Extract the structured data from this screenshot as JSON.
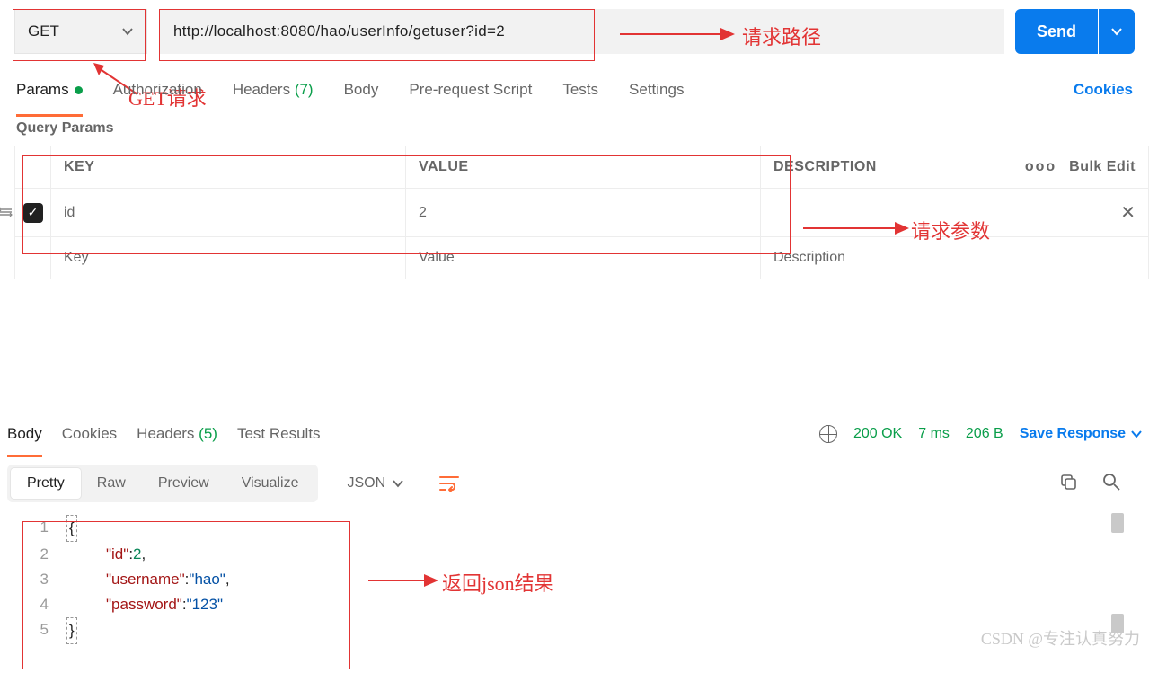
{
  "request": {
    "method": "GET",
    "url": "http://localhost:8080/hao/userInfo/getuser?id=2",
    "send_label": "Send"
  },
  "annotations": {
    "path_label": "请求路径",
    "method_label": "GET请求",
    "params_label": "请求参数",
    "result_label": "返回json结果"
  },
  "tabs": {
    "params": "Params",
    "auth": "Authorization",
    "headers": "Headers",
    "headers_count": "(7)",
    "body": "Body",
    "prereq": "Pre-request Script",
    "tests": "Tests",
    "settings": "Settings",
    "cookies": "Cookies"
  },
  "query": {
    "section": "Query Params",
    "headers": {
      "key": "KEY",
      "value": "VALUE",
      "desc": "DESCRIPTION"
    },
    "row": {
      "key": "id",
      "value": "2"
    },
    "placeholders": {
      "key": "Key",
      "value": "Value",
      "desc": "Description"
    },
    "bulk": "Bulk Edit"
  },
  "response": {
    "tabs": {
      "body": "Body",
      "cookies": "Cookies",
      "headers": "Headers",
      "headers_count": "(5)",
      "tests": "Test Results"
    },
    "status": "200 OK",
    "time": "7 ms",
    "size": "206 B",
    "save": "Save Response"
  },
  "body_toolbar": {
    "pretty": "Pretty",
    "raw": "Raw",
    "preview": "Preview",
    "visualize": "Visualize",
    "format": "JSON"
  },
  "json_body": {
    "l2_key": "\"id\"",
    "l2_val": "2",
    "l3_key": "\"username\"",
    "l3_val": "\"hao\"",
    "l4_key": "\"password\"",
    "l4_val": "\"123\""
  },
  "watermark": "CSDN @专注认真努力"
}
